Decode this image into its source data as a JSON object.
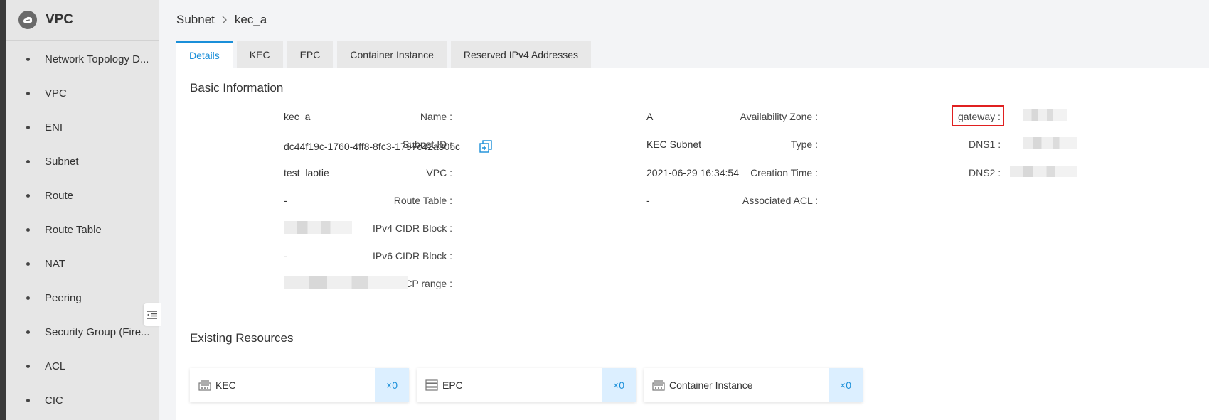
{
  "sidebar": {
    "title": "VPC",
    "items": [
      {
        "label": "Network Topology D..."
      },
      {
        "label": "VPC"
      },
      {
        "label": "ENI"
      },
      {
        "label": "Subnet"
      },
      {
        "label": "Route"
      },
      {
        "label": "Route Table"
      },
      {
        "label": "NAT"
      },
      {
        "label": "Peering"
      },
      {
        "label": "Security Group (Fire..."
      },
      {
        "label": "ACL"
      },
      {
        "label": "CIC"
      }
    ]
  },
  "breadcrumb": {
    "parent": "Subnet",
    "current": "kec_a"
  },
  "tabs": [
    {
      "label": "Details",
      "active": true
    },
    {
      "label": "KEC"
    },
    {
      "label": "EPC"
    },
    {
      "label": "Container Instance"
    },
    {
      "label": "Reserved IPv4 Addresses"
    }
  ],
  "basic": {
    "title": "Basic Information",
    "name_label": "Name :",
    "name_value": "kec_a",
    "subnet_id_label": "Subnet ID :",
    "subnet_id_value": "dc44f19c-1760-4ff8-8fc3-1797c42a305c",
    "vpc_label": "VPC :",
    "vpc_value": "test_laotie",
    "route_table_label": "Route Table :",
    "route_table_value": "-",
    "ipv4_label": "IPv4 CIDR Block :",
    "ipv6_label": "IPv6 CIDR Block :",
    "ipv6_value": "-",
    "dhcp_label": "DHCP range :",
    "az_label": "Availability Zone :",
    "az_value": "A",
    "type_label": "Type :",
    "type_value": "KEC Subnet",
    "created_label": "Creation Time :",
    "created_value": "2021-06-29 16:34:54",
    "acl_label": "Associated ACL :",
    "acl_value": "-",
    "gateway_label": "gateway :",
    "dns1_label": "DNS1 :",
    "dns2_label": "DNS2 :"
  },
  "resources": {
    "title": "Existing Resources",
    "items": [
      {
        "label": "KEC",
        "count": "×0",
        "icon": "server-icon"
      },
      {
        "label": "EPC",
        "count": "×0",
        "icon": "rack-icon"
      },
      {
        "label": "Container Instance",
        "count": "×0",
        "icon": "server-icon"
      }
    ]
  },
  "colors": {
    "accent": "#1a8fd9",
    "highlight": "#e02020"
  }
}
